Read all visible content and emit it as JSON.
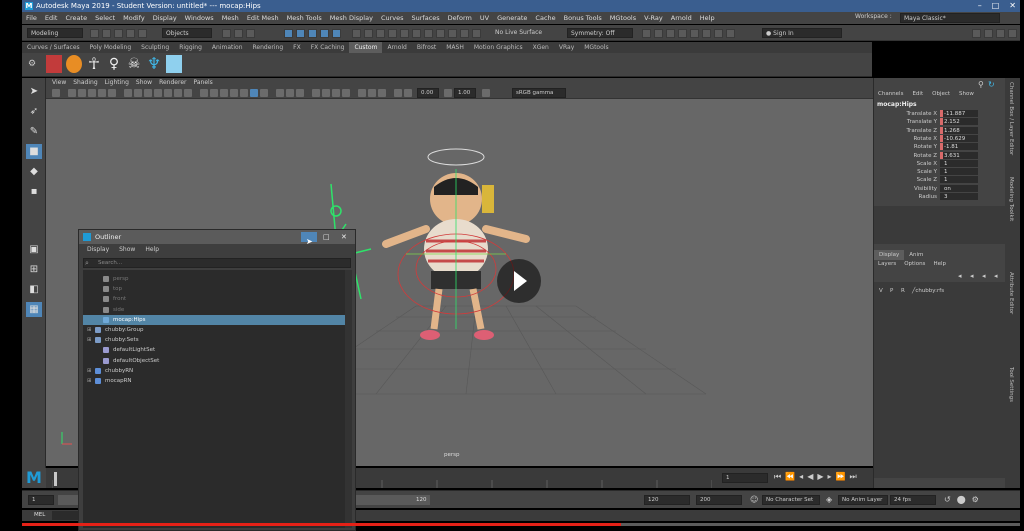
{
  "window": {
    "title": "Autodesk Maya 2019 - Student Version: untitled*   ---   mocap:Hips",
    "logo": "M",
    "controls": [
      "–",
      "□",
      "✕"
    ]
  },
  "menubar": [
    "File",
    "Edit",
    "Create",
    "Select",
    "Modify",
    "Display",
    "Windows",
    "Mesh",
    "Edit Mesh",
    "Mesh Tools",
    "Mesh Display",
    "Curves",
    "Surfaces",
    "Deform",
    "UV",
    "Generate",
    "Cache",
    "Bonus Tools",
    "MGtools",
    "V-Ray",
    "Arnold",
    "Help"
  ],
  "workspace": {
    "label": "Workspace :",
    "value": "Maya Classic*"
  },
  "statusline": {
    "menu_set": "Modeling",
    "select_mode": "Objects",
    "live_surface": "No Live Surface",
    "symmetry": "Symmetry: Off",
    "sign_in": "Sign In"
  },
  "shelf_tabs": [
    "Curves / Surfaces",
    "Poly Modeling",
    "Sculpting",
    "Rigging",
    "Animation",
    "Rendering",
    "FX",
    "FX Caching",
    "Custom",
    "Arnold",
    "Bifrost",
    "MASH",
    "Motion Graphics",
    "XGen",
    "VRay",
    "MGtools"
  ],
  "active_shelf_tab": "Custom",
  "viewport": {
    "menu": [
      "View",
      "Shading",
      "Lighting",
      "Show",
      "Renderer",
      "Panels"
    ],
    "near_value": "0.00",
    "far_value": "1.00",
    "color_space": "sRGB gamma",
    "camera_label": "persp"
  },
  "channel_box": {
    "tabs": [
      "Channels",
      "Edit",
      "Object",
      "Show"
    ],
    "node": "mocap:Hips",
    "attributes": [
      {
        "name": "Translate X",
        "value": "-11.887",
        "keyed": true
      },
      {
        "name": "Translate Y",
        "value": "2.152",
        "keyed": true
      },
      {
        "name": "Translate Z",
        "value": "1.268",
        "keyed": true
      },
      {
        "name": "Rotate X",
        "value": "-10.629",
        "keyed": true
      },
      {
        "name": "Rotate Y",
        "value": "-1.81",
        "keyed": true
      },
      {
        "name": "Rotate Z",
        "value": "3.631",
        "keyed": true
      },
      {
        "name": "Scale X",
        "value": "1",
        "keyed": false
      },
      {
        "name": "Scale Y",
        "value": "1",
        "keyed": false
      },
      {
        "name": "Scale Z",
        "value": "1",
        "keyed": false
      },
      {
        "name": "Visibility",
        "value": "on",
        "keyed": false
      },
      {
        "name": "Radius",
        "value": "3",
        "keyed": false
      }
    ]
  },
  "layer_editor": {
    "tabs": [
      "Display",
      "Anim"
    ],
    "menu": [
      "Layers",
      "Options",
      "Help"
    ],
    "columns": [
      "V",
      "P",
      "R"
    ],
    "layer_name": "chubby:rfs"
  },
  "side_tabs": [
    "Channel Box / Layer Editor",
    "Modeling Toolkit",
    "Attribute Editor",
    "Tool Settings"
  ],
  "outliner": {
    "title": "Outliner",
    "menu": [
      "Display",
      "Show",
      "Help"
    ],
    "search_placeholder": "Search...",
    "items": [
      {
        "label": "persp",
        "state": "dim",
        "indent": 1,
        "icon": "camera"
      },
      {
        "label": "top",
        "state": "dim",
        "indent": 1,
        "icon": "camera"
      },
      {
        "label": "front",
        "state": "dim",
        "indent": 1,
        "icon": "camera"
      },
      {
        "label": "side",
        "state": "dim",
        "indent": 1,
        "icon": "camera"
      },
      {
        "label": "mocap:Hips",
        "state": "sel",
        "indent": 1,
        "icon": "joint"
      },
      {
        "label": "chubby:Group",
        "state": "normal",
        "indent": 0,
        "icon": "group"
      },
      {
        "label": "chubby:Sets",
        "state": "normal",
        "indent": 0,
        "icon": "group"
      },
      {
        "label": "defaultLightSet",
        "state": "normal",
        "indent": 1,
        "icon": "set"
      },
      {
        "label": "defaultObjectSet",
        "state": "normal",
        "indent": 1,
        "icon": "set"
      },
      {
        "label": "chubbyRN",
        "state": "normal",
        "indent": 0,
        "icon": "ref"
      },
      {
        "label": "mocapRN",
        "state": "normal",
        "indent": 0,
        "icon": "ref"
      }
    ]
  },
  "time": {
    "current_frame": "1",
    "range_start": "1",
    "range_end_inner": "120",
    "anim_end": "120",
    "max_end": "200",
    "character_set": "No Character Set",
    "anim_layer": "No Anim Layer",
    "fps": "24 fps"
  },
  "command_line": {
    "label": "MEL"
  },
  "video_progress_fraction": 0.6,
  "colors": {
    "accent": "#1f9bd6",
    "selection": "#5285a6",
    "progress": "#e62117",
    "keyed": "#d86a6a"
  }
}
